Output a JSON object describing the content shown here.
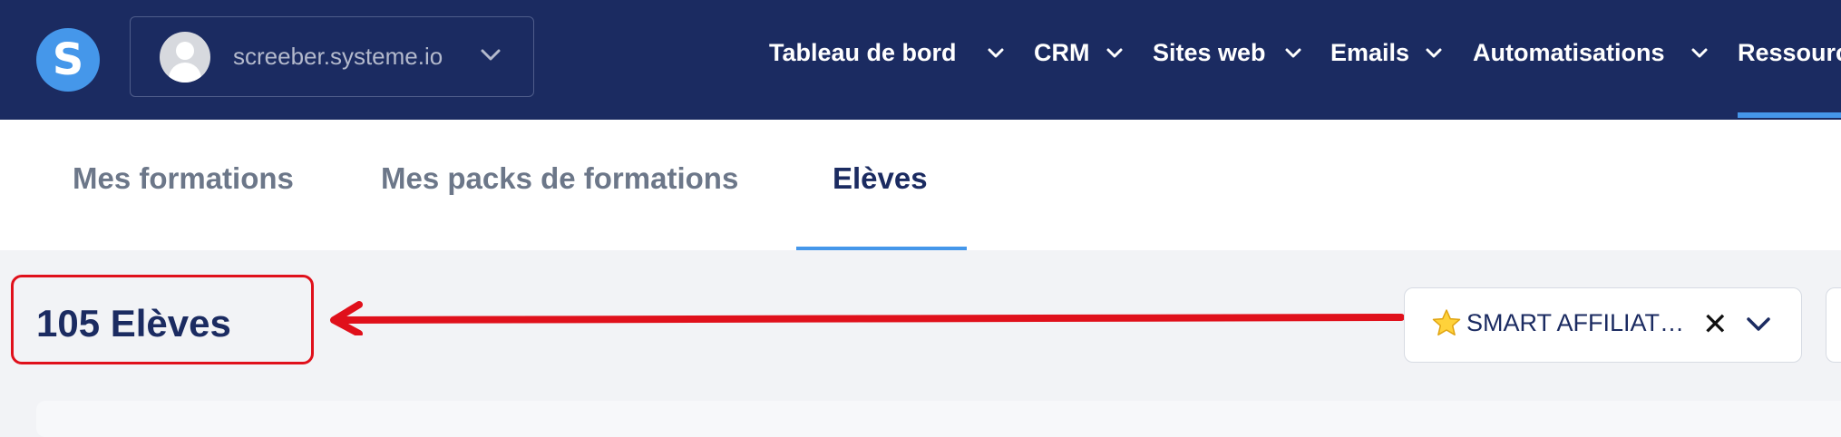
{
  "header": {
    "logo_letter": "S",
    "account": {
      "name": "screeber.systeme.io"
    },
    "nav": [
      {
        "label": "Tableau de bord"
      },
      {
        "label": "CRM"
      },
      {
        "label": "Sites web"
      },
      {
        "label": "Emails"
      },
      {
        "label": "Automatisations"
      },
      {
        "label": "Ressourc"
      }
    ]
  },
  "tabs": [
    {
      "label": "Mes formations",
      "active": false
    },
    {
      "label": "Mes packs de formations",
      "active": false
    },
    {
      "label": "Elèves",
      "active": true
    }
  ],
  "students": {
    "count_label": "105 Elèves"
  },
  "filter": {
    "icon": "star-icon",
    "value": "SMART AFFILIAT…"
  },
  "annotation": {
    "highlight_color": "#e0101b"
  },
  "colors": {
    "navy": "#1b2b61",
    "accent": "#4597ea"
  }
}
